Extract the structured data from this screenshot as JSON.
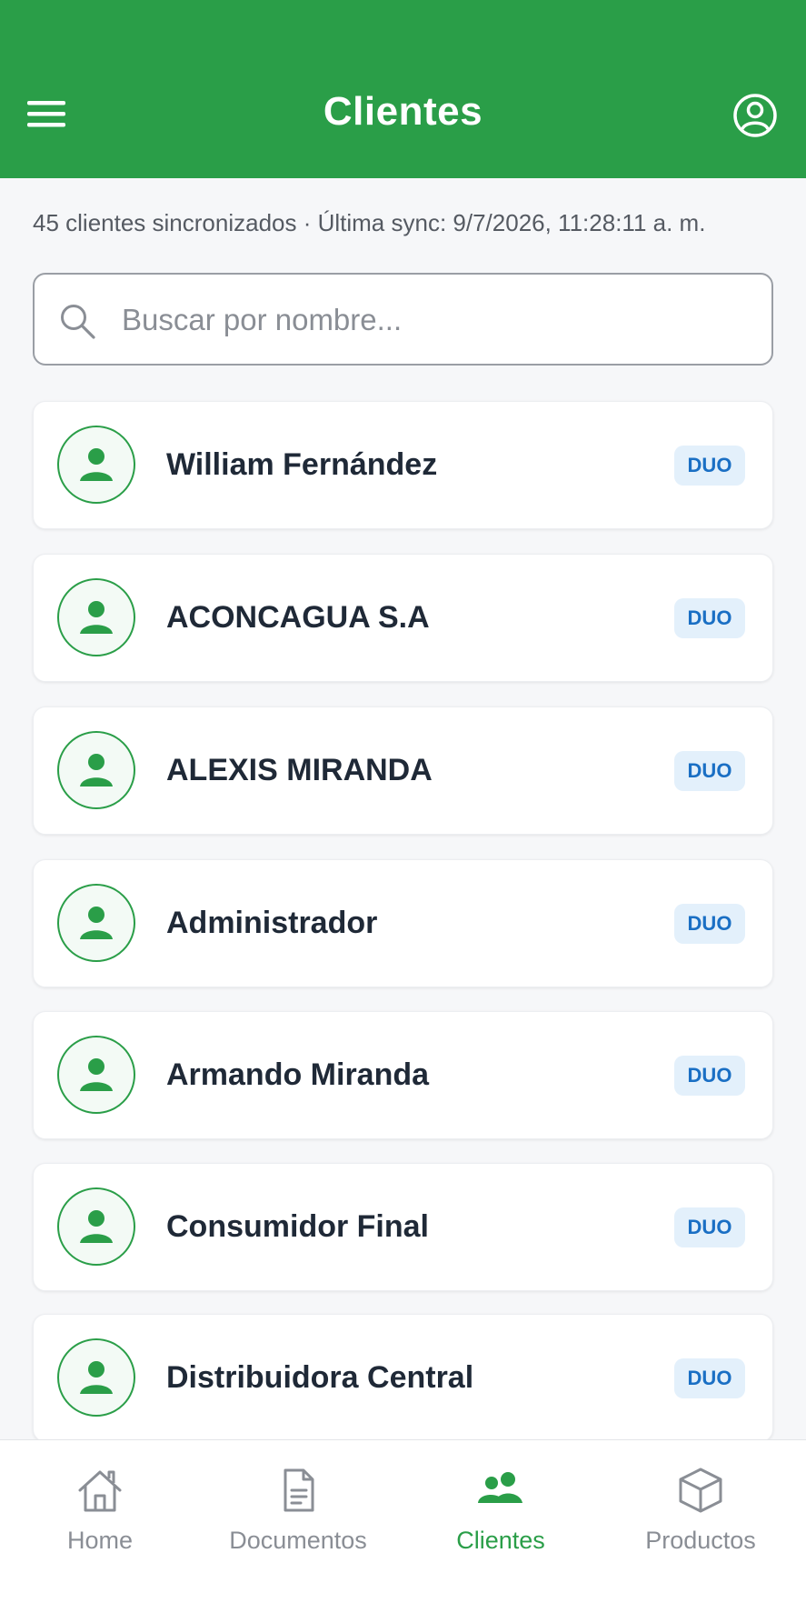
{
  "header": {
    "title": "Clientes",
    "menu_icon": "hamburger-menu-icon",
    "profile_icon": "user-circle-icon",
    "color": "#2a9e48"
  },
  "sync_info": "45 clientes sincronizados · Última sync: 9/7/2026, 11:28:11 a. m.",
  "search": {
    "placeholder": "Buscar por nombre...",
    "value": "",
    "icon": "search-icon"
  },
  "clients": [
    {
      "name": "William Fernández",
      "badge": "DUO"
    },
    {
      "name": "ACONCAGUA S.A",
      "badge": "DUO"
    },
    {
      "name": "ALEXIS MIRANDA",
      "badge": "DUO"
    },
    {
      "name": "Administrador",
      "badge": "DUO"
    },
    {
      "name": "Armando Miranda",
      "badge": "DUO"
    },
    {
      "name": "Consumidor Final",
      "badge": "DUO"
    },
    {
      "name": "Distribuidora Central",
      "badge": "DUO"
    }
  ],
  "tabs": [
    {
      "label": "Home",
      "icon": "home-icon",
      "active": false
    },
    {
      "label": "Documentos",
      "icon": "document-icon",
      "active": false
    },
    {
      "label": "Clientes",
      "icon": "users-icon",
      "active": true
    },
    {
      "label": "Productos",
      "icon": "box-icon",
      "active": false
    }
  ],
  "colors": {
    "accent": "#2a9e48",
    "badge_bg": "#e3f0fb",
    "badge_text": "#1a6fc4",
    "inactive_tab": "#8a8e95"
  }
}
